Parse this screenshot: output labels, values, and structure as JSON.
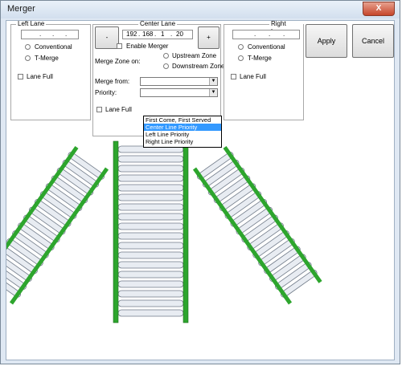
{
  "window": {
    "title": "Merger",
    "close_glyph": "X"
  },
  "left_lane": {
    "caption": "Left Lane",
    "ip_dots": [
      ".",
      ".",
      "."
    ],
    "options": [
      "Conventional",
      "T-Merge"
    ],
    "lane_full_label": "Lane Full"
  },
  "center_lane": {
    "caption": "Center Lane",
    "minus_label": "-",
    "plus_label": "+",
    "ip_octets": [
      "192",
      "168",
      "1",
      "20"
    ],
    "ip_dots": [
      ".",
      ".",
      "."
    ],
    "enable_merger_label": "Enable Merger",
    "merge_zone_label": "Merge Zone on:",
    "zone_options": [
      "Upstream Zone",
      "Downstream Zone"
    ],
    "merge_from_label": "Merge from:",
    "priority_label": "Priority:",
    "lane_full_label": "Lane Full",
    "priority_options": [
      "First Come, First Served",
      "Center Line Priority",
      "Left Line Priority",
      "Right Line Priority"
    ],
    "priority_highlighted": "Center Line Priority"
  },
  "right_lane": {
    "caption": "Right Lane",
    "ip_dots": [
      ".",
      ".",
      "."
    ],
    "options": [
      "Conventional",
      "T-Merge"
    ],
    "lane_full_label": "Lane Full"
  },
  "buttons": {
    "apply": "Apply",
    "cancel": "Cancel"
  },
  "colors": {
    "rail": "#2da52d",
    "roller": "#e8ecf2",
    "highlight": "#3399ff"
  },
  "icons": {
    "dropdown": "chevron-down-icon",
    "close": "close-icon"
  }
}
